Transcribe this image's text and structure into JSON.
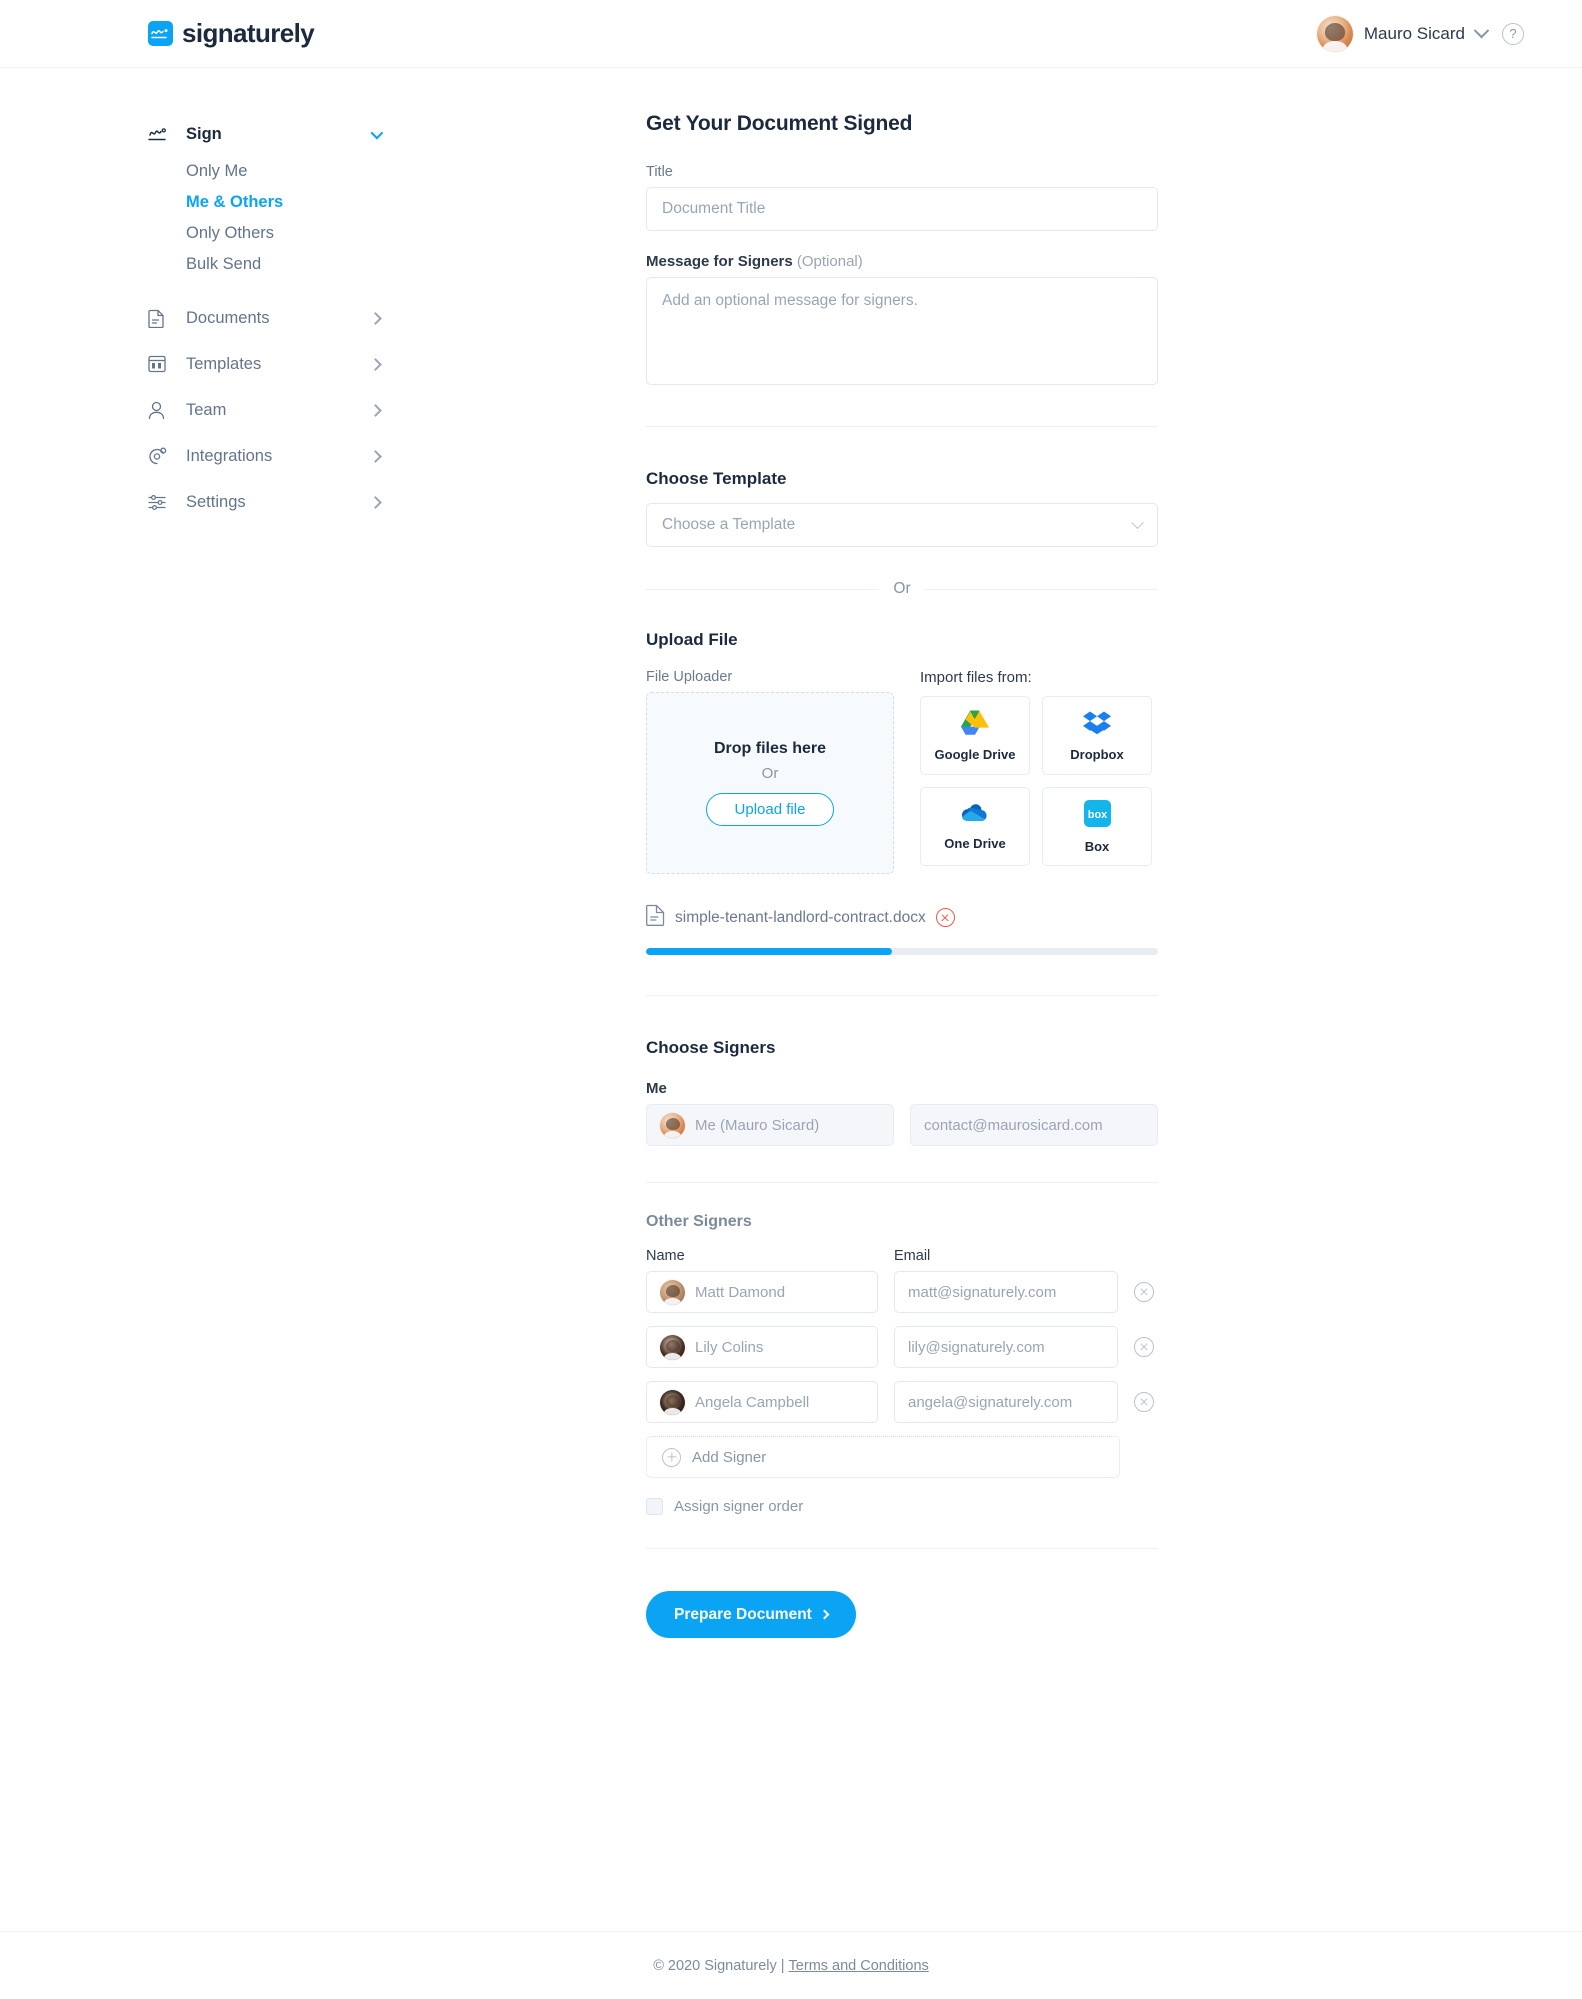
{
  "brand": {
    "name": "signaturely",
    "accent": "#0ba3f4",
    "dark": "#1c2a3e"
  },
  "header": {
    "logo_text": "signaturely",
    "user_name": "Mauro Sicard",
    "help_label": "?"
  },
  "sidebar": {
    "sign": {
      "label": "Sign",
      "children": [
        {
          "label": "Only Me",
          "active": false
        },
        {
          "label": "Me & Others",
          "active": true
        },
        {
          "label": "Only Others",
          "active": false
        },
        {
          "label": "Bulk Send",
          "active": false
        }
      ]
    },
    "items": [
      {
        "label": "Documents"
      },
      {
        "label": "Templates"
      },
      {
        "label": "Team"
      },
      {
        "label": "Integrations"
      },
      {
        "label": "Settings"
      }
    ]
  },
  "main": {
    "page_title": "Get Your Document Signed",
    "title_field": {
      "label": "Title",
      "placeholder": "Document Title",
      "value": ""
    },
    "message_field": {
      "label": "Message for Signers",
      "optional_suffix": "(Optional)",
      "placeholder": "Add an optional message for signers.",
      "value": ""
    },
    "template": {
      "heading": "Choose Template",
      "placeholder": "Choose a Template",
      "value": ""
    },
    "or_divider": "Or",
    "upload": {
      "heading": "Upload File",
      "uploader_label": "File Uploader",
      "drop_title": "Drop files here",
      "drop_or": "Or",
      "upload_button": "Upload file",
      "import_label": "Import files from:",
      "providers": [
        {
          "name": "Google Drive",
          "icon": "google-drive-icon"
        },
        {
          "name": "Dropbox",
          "icon": "dropbox-icon"
        },
        {
          "name": "One Drive",
          "icon": "onedrive-icon"
        },
        {
          "name": "Box",
          "icon": "box-icon"
        }
      ],
      "file": {
        "name": "simple-tenant-landlord-contract.docx",
        "progress_percent": 48
      }
    },
    "signers": {
      "heading": "Choose Signers",
      "me_label": "Me",
      "me_name": "Me (Mauro Sicard)",
      "me_email": "contact@maurosicard.com",
      "others_label": "Other Signers",
      "col_name": "Name",
      "col_email": "Email",
      "rows": [
        {
          "name": "Matt Damond",
          "email": "matt@signaturely.com"
        },
        {
          "name": "Lily Colins",
          "email": "lily@signaturely.com"
        },
        {
          "name": "Angela Campbell",
          "email": "angela@signaturely.com"
        }
      ],
      "add_signer": "Add Signer",
      "assign_order": "Assign signer order",
      "assign_order_checked": false
    },
    "submit_button": "Prepare Document"
  },
  "footer": {
    "copyright": "© 2020 Signaturely |",
    "terms": "Terms and Conditions"
  }
}
